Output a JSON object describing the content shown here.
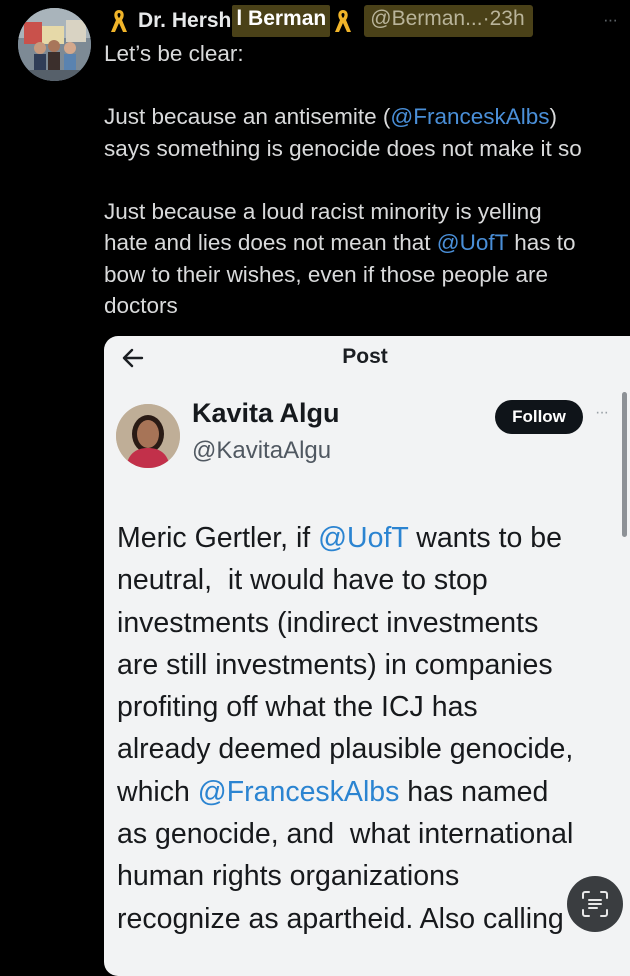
{
  "tweet": {
    "display_name_part1": "Dr. Hersh",
    "display_name_part2": "l Berman",
    "handle_time": "@Berman...·23h",
    "more": "···",
    "body_line1": "Let’s be clear:",
    "body_p2_pre": "Just because an antisemite (",
    "body_p2_mention": "@FranceskAlbs",
    "body_p2_post": ")\nsays something is genocide does not make it so",
    "body_p3_pre": "Just because a loud racist minority is yelling\nhate and lies does not mean that ",
    "body_p3_mention": "@UofT",
    "body_p3_post": " has to\nbow to their wishes, even if those people are\ndoctors",
    "icons": [
      "yellow-ribbon-icon",
      "yellow-ribbon-icon"
    ],
    "ribbon_color": "#f0b429"
  },
  "quoted": {
    "page_title": "Post",
    "name": "Kavita Algu",
    "handle": "@KavitaAlgu",
    "follow_label": "Follow",
    "more": "···",
    "body_a": "Meric Gertler, if ",
    "mention_a": "@UofT",
    "body_b": " wants to be\nneutral,  it would have to stop\ninvestments (indirect investments\nare still investments) in companies\nprofiting off what the ICJ has\nalready deemed plausible genocide,\nwhich ",
    "mention_b": "@FranceskAlbs",
    "body_c": " has named\nas genocide, and  what international\nhuman rights organizations\nrecognize as apartheid. Also calling",
    "icons": [
      "back-arrow-icon",
      "lens-scan-icon"
    ]
  },
  "colors": {
    "background": "#000000",
    "mention": "#4a8fd8",
    "highlight": "#4a4118",
    "card_bg": "#f2f3f4"
  }
}
